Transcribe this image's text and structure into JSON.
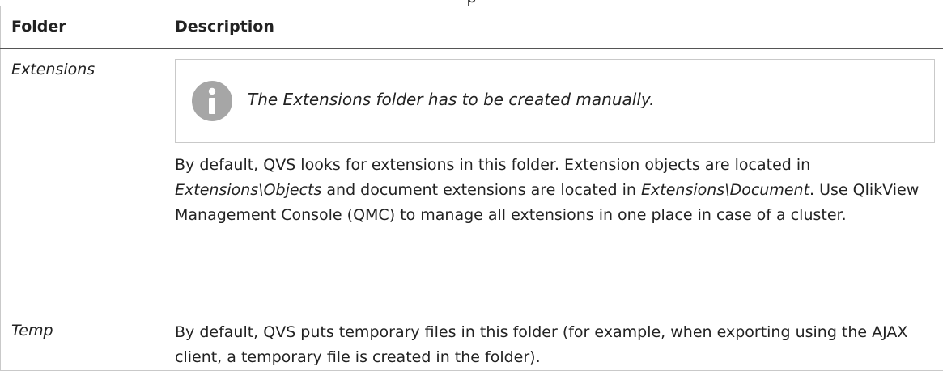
{
  "header_fragment": "p",
  "table": {
    "columns": [
      "Folder",
      "Description"
    ],
    "rows": [
      {
        "folder": "Extensions",
        "note": {
          "icon": "info-icon",
          "icon_color": "#a6a6a6",
          "text": "The Extensions folder has to be created manually."
        },
        "description": {
          "part1": "By default, QVS looks for extensions in this folder. Extension objects are located in ",
          "path1": "Extensions\\Objects",
          "part2": " and document extensions are located in ",
          "path2": "Extensions\\Document",
          "part3": ". Use QlikView Management Console (QMC) to manage all extensions in one place in case of a cluster."
        }
      },
      {
        "folder": "Temp",
        "description": {
          "text": "By default, QVS puts temporary files in this folder (for example, when exporting using the AJAX client, a temporary file is created in the folder)."
        }
      }
    ]
  }
}
